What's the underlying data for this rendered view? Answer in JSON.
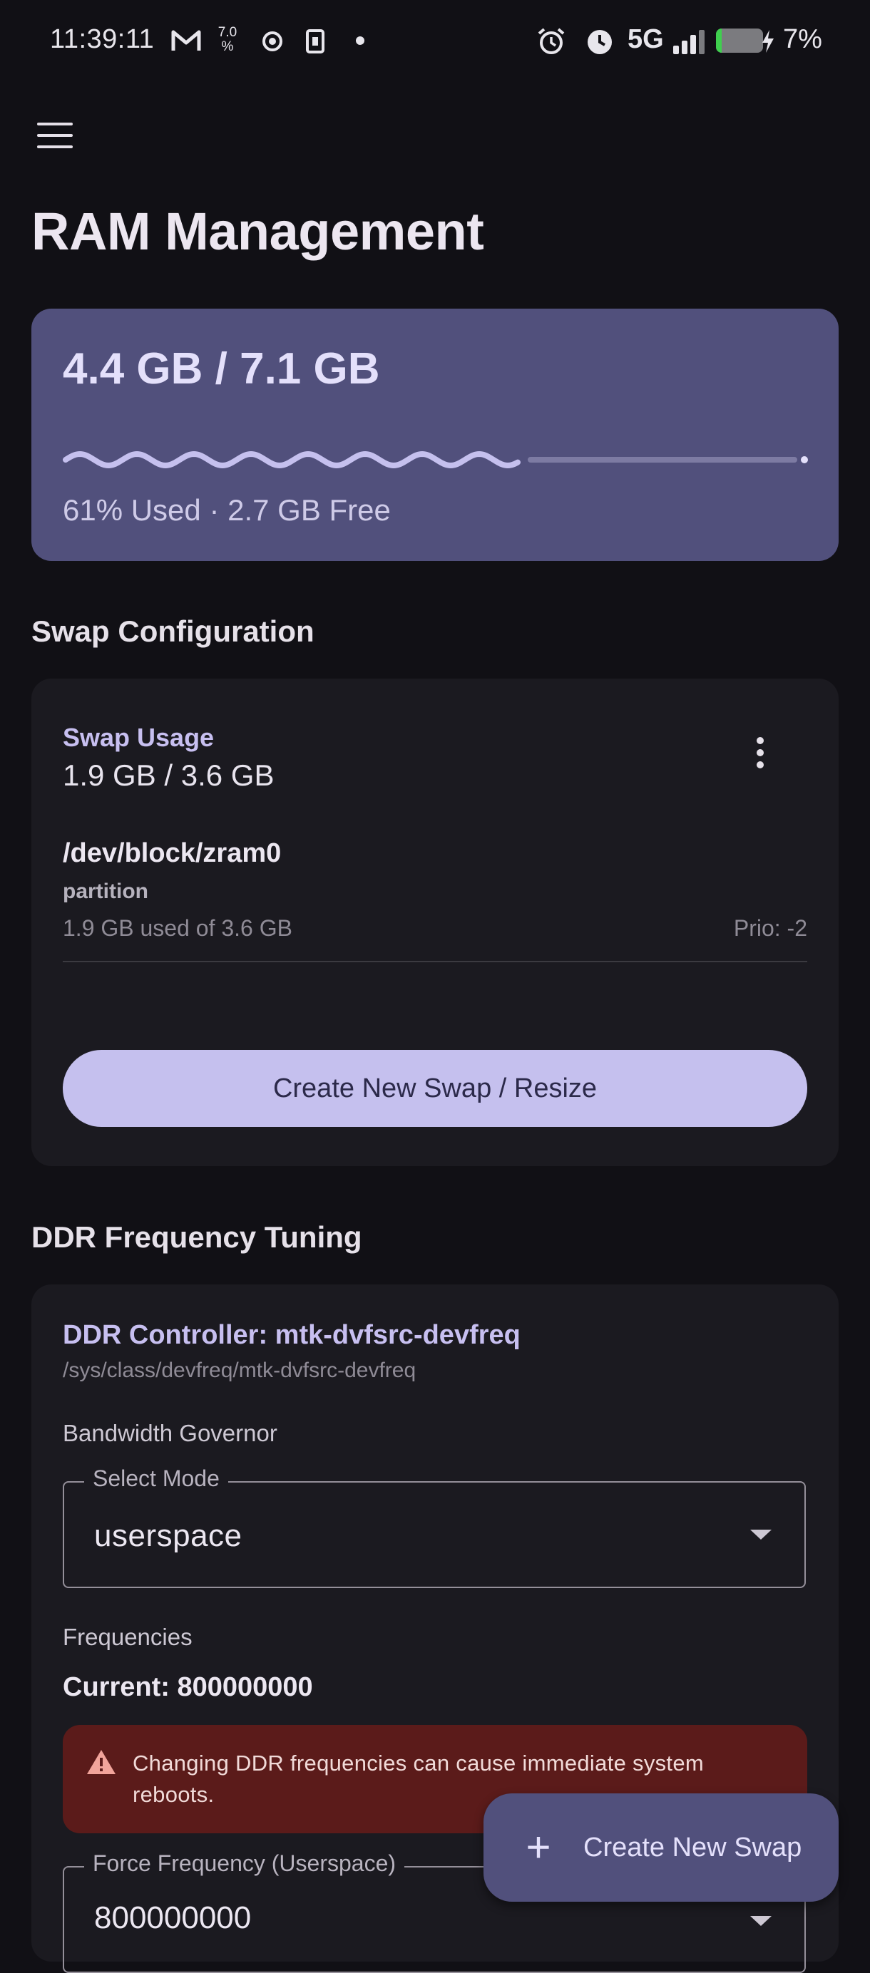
{
  "status_bar": {
    "time": "11:39:11",
    "battery": "7%",
    "network": "5G",
    "icons": [
      "gmail-icon",
      "data-speed-icon",
      "record-icon",
      "sim-icon",
      "dot-icon",
      "alarm-icon",
      "clock-icon",
      "signal-icon",
      "battery-icon",
      "charging-icon"
    ],
    "data_speed_top": "7.0",
    "data_speed_bottom": "%"
  },
  "header": {
    "menu_icon": "hamburger-menu-icon",
    "title": "RAM Management"
  },
  "ram": {
    "usage": "4.4 GB / 7.1 GB",
    "summary": "61% Used · 2.7 GB Free",
    "progress_fraction": 0.61
  },
  "swap_section": {
    "title": "Swap Configuration",
    "usage_label": "Swap Usage",
    "usage_value": "1.9 GB / 3.6 GB",
    "device": {
      "name": "/dev/block/zram0",
      "type": "partition",
      "used": "1.9 GB used of 3.6 GB",
      "priority": "Prio: -2"
    },
    "button_label": "Create New Swap / Resize"
  },
  "ddr_section": {
    "title": "DDR Frequency Tuning",
    "controller": "DDR Controller: mtk-dvfsrc-devfreq",
    "path": "/sys/class/devfreq/mtk-dvfsrc-devfreq",
    "governor_label": "Bandwidth Governor",
    "select_legend": "Select Mode",
    "select_value": "userspace",
    "frequencies_label": "Frequencies",
    "current": "Current: 800000000",
    "warning": "Changing DDR frequencies can cause immediate system reboots.",
    "force_legend": "Force Frequency (Userspace)",
    "force_value": "800000000"
  },
  "fab": {
    "label": "Create New Swap"
  },
  "colors": {
    "background": "#111015",
    "accent": "#c5c0ee",
    "ram_card": "#51507c",
    "card": "#1b1a20",
    "warning_bg": "#5b1b1a"
  }
}
